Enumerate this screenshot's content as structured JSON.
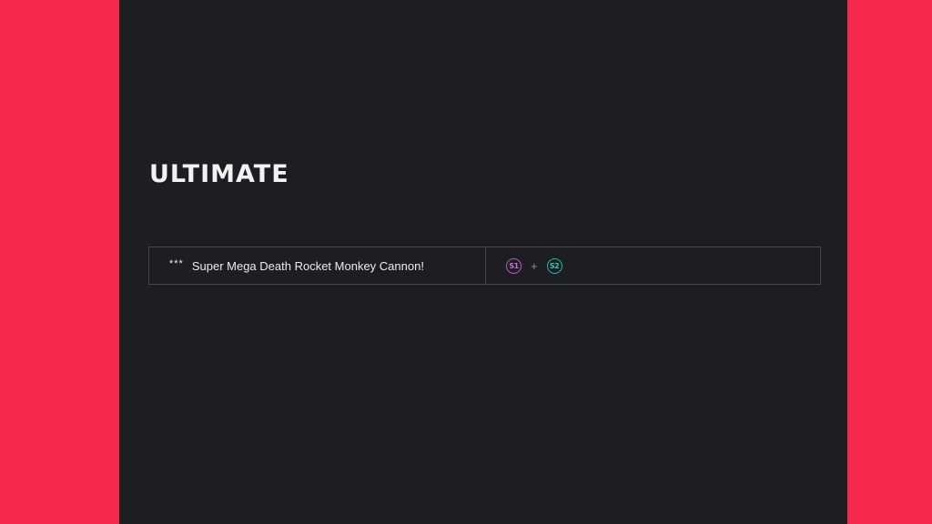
{
  "section": {
    "title": "ULTIMATE"
  },
  "moves": [
    {
      "stars": "***",
      "name": "Super Mega Death Rocket Monkey Cannon!",
      "input": {
        "button_1": "S1",
        "separator": "+",
        "button_2": "S2"
      }
    }
  ],
  "colors": {
    "background_accent": "#f52a4e",
    "panel": "#1d1e21",
    "s1_button": "#c04fd6",
    "s2_button": "#1fb7a6"
  },
  "icons": {
    "button_1": "s1-button-icon",
    "button_2": "s2-button-icon"
  }
}
